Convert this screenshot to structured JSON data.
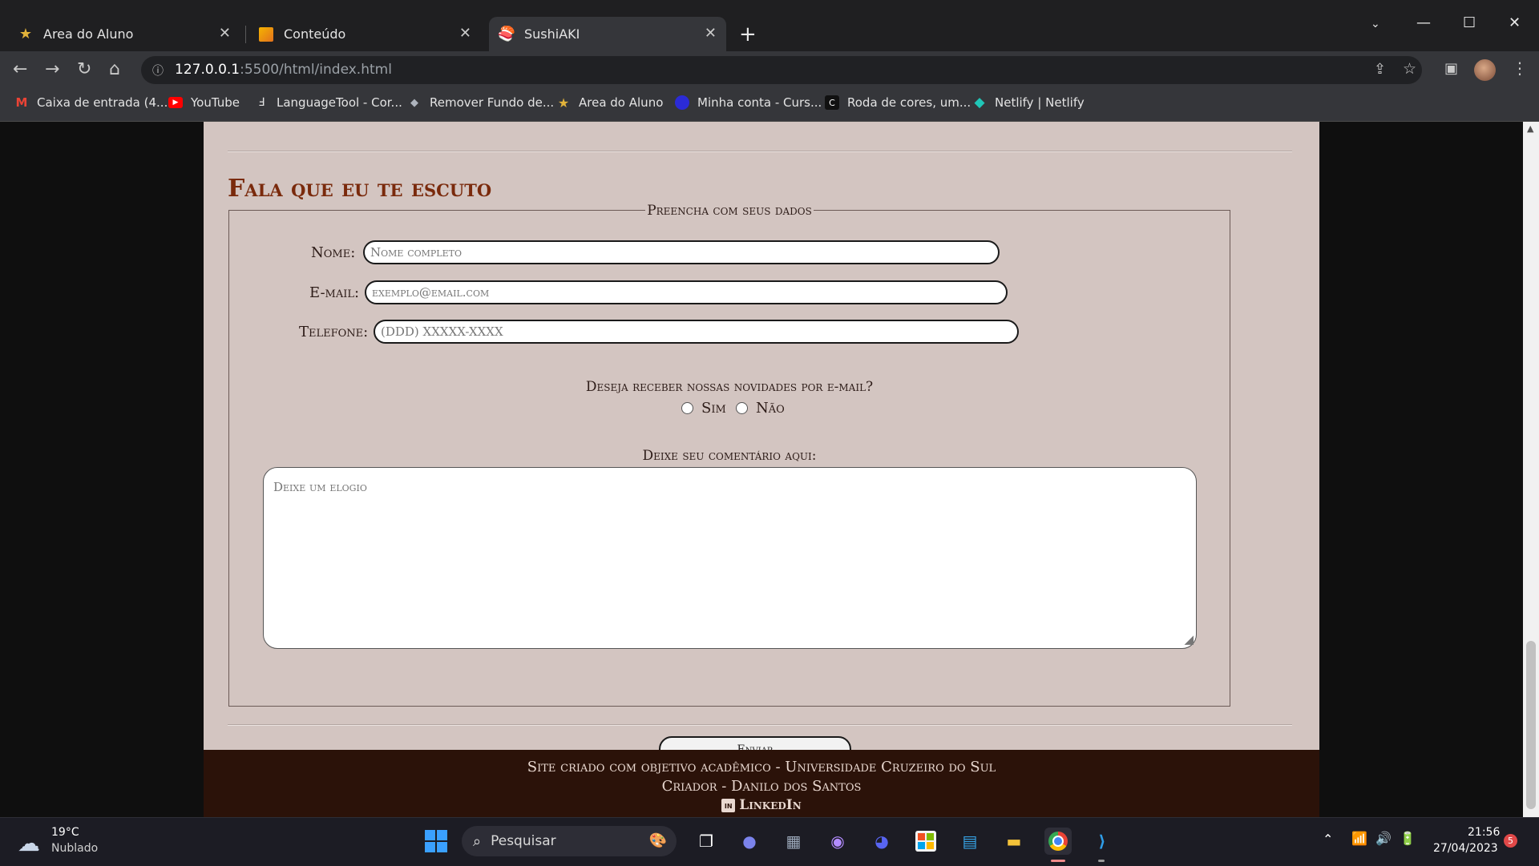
{
  "browser": {
    "tabs": [
      {
        "title": "Area do Aluno",
        "icon": "star-logo-icon",
        "active": false
      },
      {
        "title": "Conteúdo",
        "icon": "notes-icon",
        "active": false
      },
      {
        "title": "SushiAKI",
        "icon": "sushi-icon",
        "active": true
      }
    ],
    "url": {
      "host": "127.0.0.1",
      "path": ":5500/html/index.html"
    },
    "bookmarks": [
      {
        "label": "Caixa de entrada (4....",
        "icon": "gmail-icon"
      },
      {
        "label": "YouTube",
        "icon": "youtube-icon"
      },
      {
        "label": "LanguageTool - Cor...",
        "icon": "languagetool-icon"
      },
      {
        "label": "Remover Fundo de...",
        "icon": "layers-icon"
      },
      {
        "label": "Area do Aluno",
        "icon": "star-logo-icon"
      },
      {
        "label": "Minha conta - Curs...",
        "icon": "course-icon"
      },
      {
        "label": "Roda de cores, um...",
        "icon": "color-wheel-icon"
      },
      {
        "label": "Netlify | Netlify",
        "icon": "netlify-icon"
      }
    ]
  },
  "page": {
    "section_title": "Fala que eu te escuto",
    "form": {
      "legend": "Preencha com seus dados",
      "name_label": "Nome:",
      "name_placeholder": "Nome completo",
      "email_label": "E-mail:",
      "email_placeholder": "exemplo@email.com",
      "phone_label": "Telefone:",
      "phone_placeholder": "(DDD) XXXXX-XXXX",
      "newsletter_question": "Deseja receber nossas novidades por e-mail?",
      "option_yes": "Sim",
      "option_no": "Não",
      "comment_label": "Deixe seu comentário aqui:",
      "comment_placeholder": "Deixe um elogio",
      "submit_label": "Enviar"
    },
    "footer": {
      "line1": "Site criado com objetivo acadêmico - Universidade Cruzeiro do Sul",
      "line2": "Criador - Danilo dos Santos",
      "linkedin_label": "LinkedIn"
    }
  },
  "taskbar": {
    "weather": {
      "temp": "19°C",
      "condition": "Nublado"
    },
    "search_label": "Pesquisar",
    "clock": {
      "time": "21:56",
      "date": "27/04/2023"
    },
    "notification_count": "5"
  }
}
